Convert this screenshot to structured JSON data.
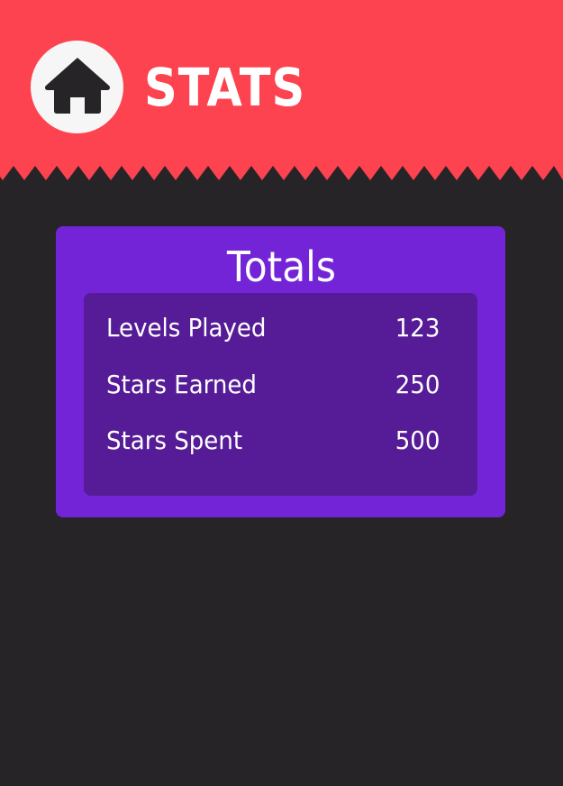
{
  "header": {
    "title": "STATS",
    "home_icon": "home-icon",
    "background_color": "#fd4250"
  },
  "totals": {
    "title": "Totals",
    "rows": [
      {
        "label": "Levels Played",
        "value": "123"
      },
      {
        "label": "Stars Earned",
        "value": "250"
      },
      {
        "label": "Stars Spent",
        "value": "500"
      }
    ]
  },
  "colors": {
    "background": "#262427",
    "panel": "#7324d6",
    "panel_inner": "#561c97",
    "text": "#ffffff"
  }
}
